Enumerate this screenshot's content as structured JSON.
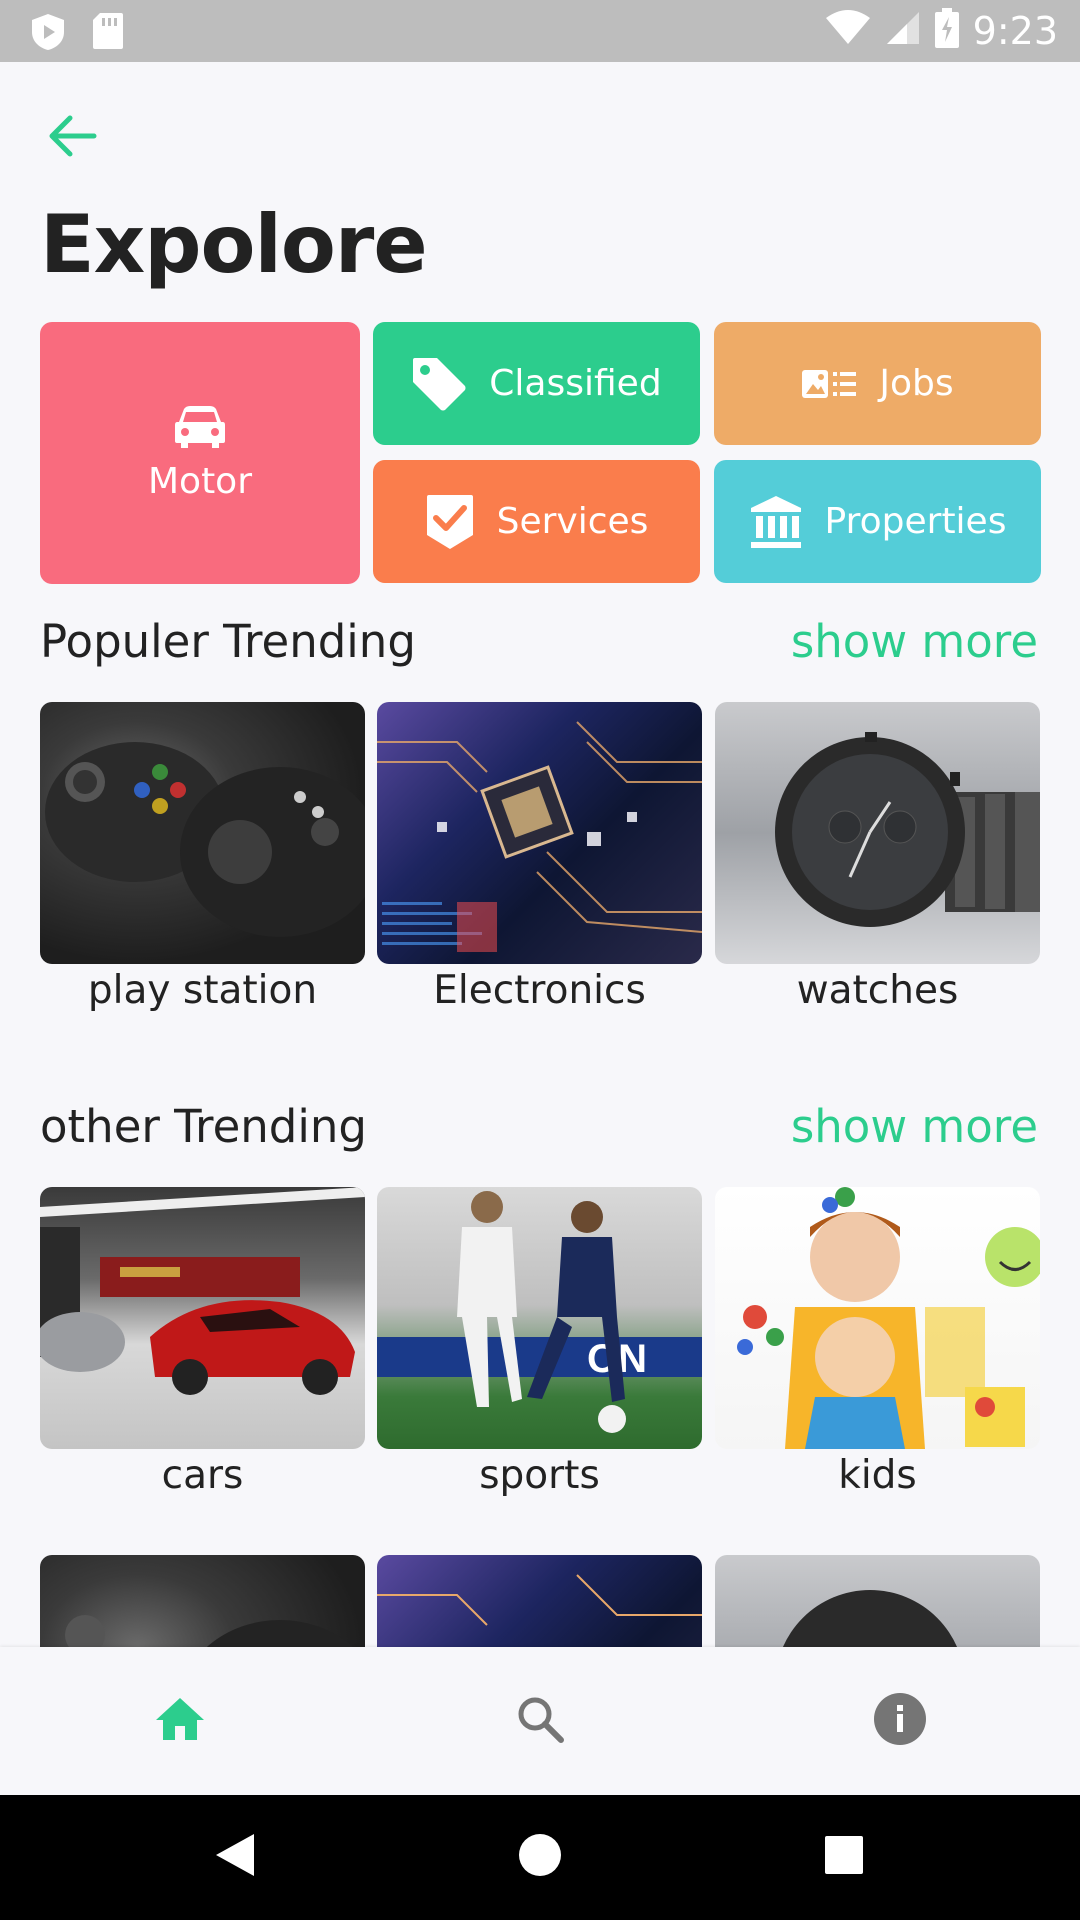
{
  "status_bar": {
    "time": "9:23"
  },
  "header": {
    "title": "Expolore"
  },
  "categories": {
    "motor": "Motor",
    "classified": "Classified",
    "jobs": "Jobs",
    "services": "Services",
    "properties": "Properties"
  },
  "sections": [
    {
      "title": "Populer Trending",
      "show_more": "show more",
      "items": [
        {
          "label": "play station"
        },
        {
          "label": "Electronics"
        },
        {
          "label": "watches"
        }
      ]
    },
    {
      "title": "other Trending",
      "show_more": "show more",
      "items": [
        {
          "label": "cars"
        },
        {
          "label": "sports"
        },
        {
          "label": "kids"
        }
      ]
    }
  ],
  "colors": {
    "accent": "#2ccd8d",
    "motor": "#f96b7e",
    "classified": "#2ccd8d",
    "jobs": "#eeab67",
    "services": "#fa7d4c",
    "properties": "#54cdd8"
  },
  "bottom_nav": {
    "items": [
      {
        "icon": "home-icon",
        "active": true
      },
      {
        "icon": "search-icon",
        "active": false
      },
      {
        "icon": "info-icon",
        "active": false
      }
    ]
  }
}
